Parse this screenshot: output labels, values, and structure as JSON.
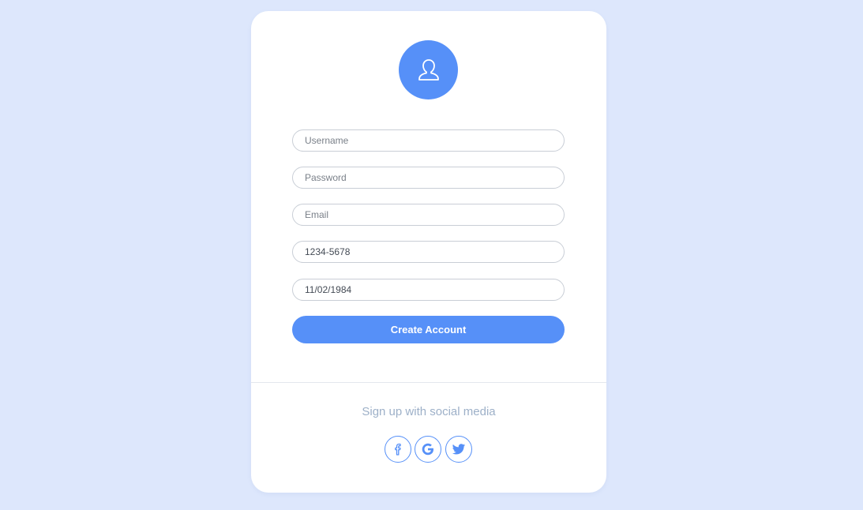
{
  "form": {
    "avatar_icon": "user-icon",
    "fields": [
      {
        "name": "username",
        "placeholder": "Username",
        "value": ""
      },
      {
        "name": "password",
        "placeholder": "Password",
        "value": ""
      },
      {
        "name": "email",
        "placeholder": "Email",
        "value": ""
      },
      {
        "name": "phone",
        "placeholder": "",
        "value": "1234-5678"
      },
      {
        "name": "birthdate",
        "placeholder": "",
        "value": "11/02/1984"
      }
    ],
    "submit_label": "Create Account"
  },
  "social": {
    "prompt": "Sign up with social media",
    "buttons": [
      {
        "name": "facebook",
        "icon": "facebook-icon"
      },
      {
        "name": "google",
        "icon": "google-icon"
      },
      {
        "name": "twitter",
        "icon": "twitter-icon"
      }
    ]
  },
  "colors": {
    "background": "#dde7fc",
    "accent": "#5690f8",
    "card": "#ffffff",
    "muted_text": "#9db0c8"
  }
}
